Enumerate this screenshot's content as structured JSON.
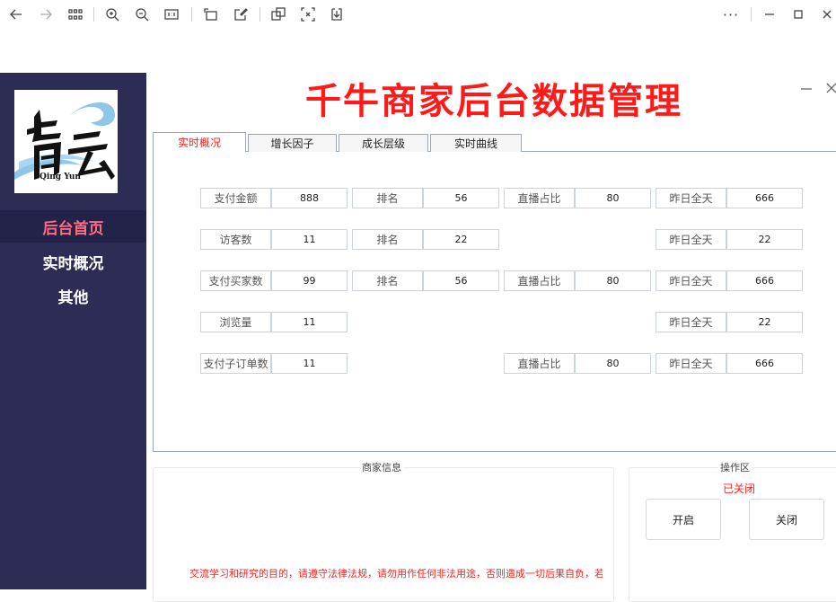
{
  "app": {
    "title": "千牛商家后台数据管理"
  },
  "sidebar": {
    "logo": {
      "text": "Qing Yun"
    },
    "items": [
      {
        "label": "后台首页",
        "active": true
      },
      {
        "label": "实时概况",
        "active": false
      },
      {
        "label": "其他",
        "active": false
      }
    ]
  },
  "tabs": [
    {
      "label": "实时概况",
      "active": true
    },
    {
      "label": "增长因子",
      "active": false
    },
    {
      "label": "成长层级",
      "active": false
    },
    {
      "label": "实时曲线",
      "active": false
    }
  ],
  "metrics": {
    "row1": {
      "pay_amount_label": "支付金额",
      "pay_amount": "888",
      "rank_label": "排名",
      "rank": "56",
      "live_ratio_label": "直播占比",
      "live_ratio": "80",
      "yesterday_label": "昨日全天",
      "yesterday": "666"
    },
    "row2": {
      "visitors_label": "访客数",
      "visitors": "11",
      "rank_label": "排名",
      "rank": "22",
      "yesterday_label": "昨日全天",
      "yesterday": "22"
    },
    "row3": {
      "buyers_label": "支付买家数",
      "buyers": "99",
      "rank_label": "排名",
      "rank": "56",
      "live_ratio_label": "直播占比",
      "live_ratio": "80",
      "yesterday_label": "昨日全天",
      "yesterday": "666"
    },
    "row4": {
      "views_label": "浏览量",
      "views": "11",
      "yesterday_label": "昨日全天",
      "yesterday": "22"
    },
    "row5": {
      "suborders_label": "支付子订单数",
      "suborders": "11",
      "live_ratio_label": "直播占比",
      "live_ratio": "80",
      "yesterday_label": "昨日全天",
      "yesterday": "666"
    }
  },
  "merchant_info": {
    "title": "商家信息",
    "notice": "交流学习和研究的目的，请遵守法律法规，请勿用作任何非法用途，否则造成一切后果自负，若"
  },
  "operations": {
    "title": "操作区",
    "status": "已关闭",
    "open_label": "开启",
    "close_label": "关闭"
  },
  "colors": {
    "sidebar": "#2c2c54",
    "accent": "#ff2020",
    "nav_active": "#ff6b81"
  }
}
